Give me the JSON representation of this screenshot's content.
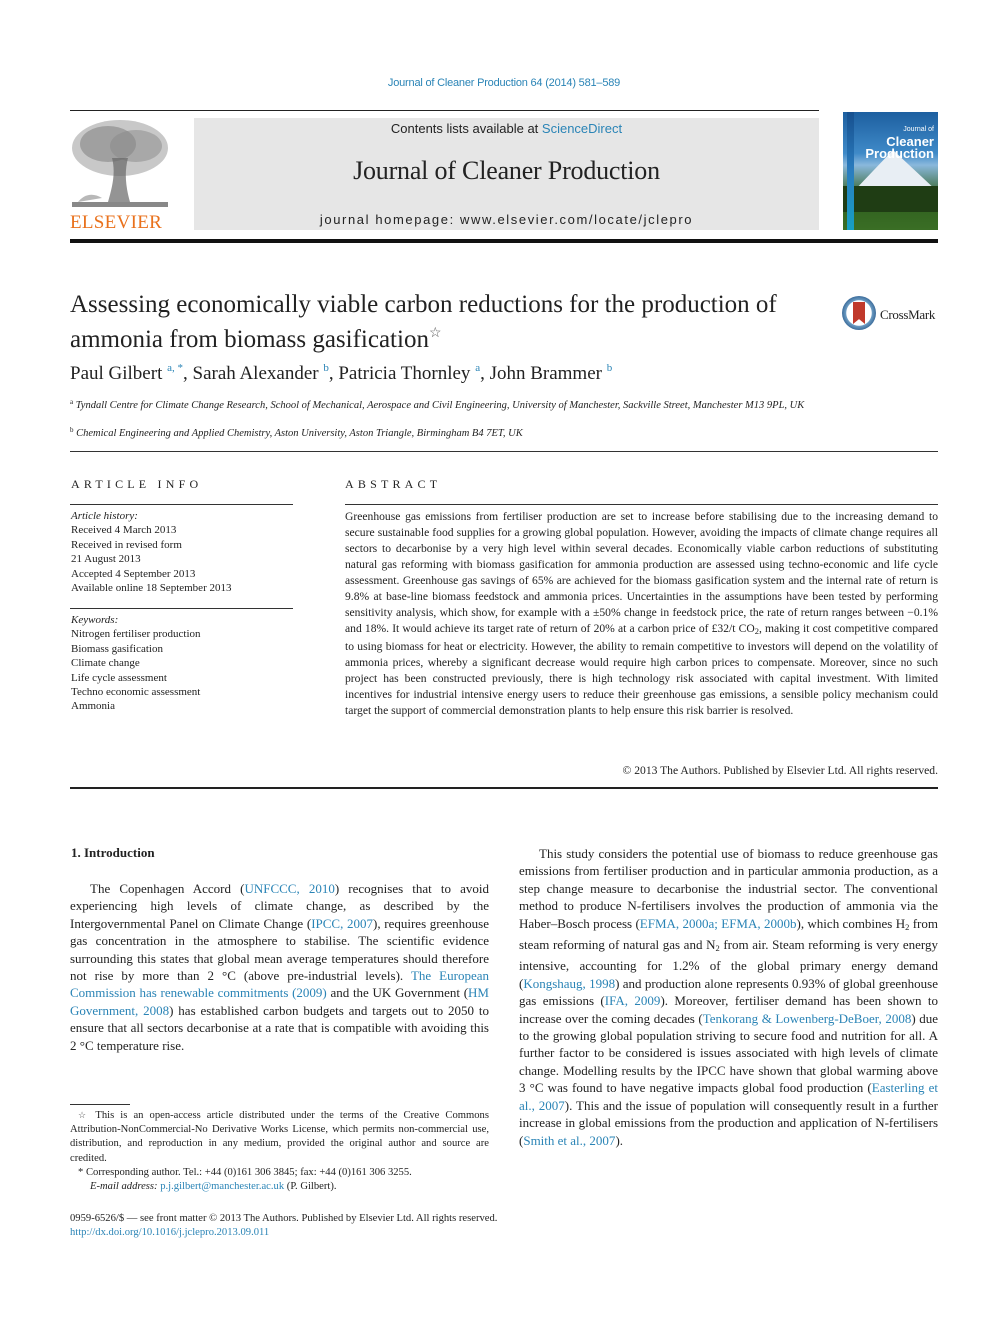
{
  "header": {
    "citation": "Journal of Cleaner Production 64 (2014) 581–589",
    "contents_prefix": "Contents lists available at ",
    "contents_link": "ScienceDirect",
    "journal_title": "Journal of Cleaner Production",
    "homepage": "journal homepage: www.elsevier.com/locate/jclepro",
    "publisher_logo": "ELSEVIER",
    "cover": {
      "line1": "Journal of",
      "line2": "Cleaner",
      "line3": "Production"
    },
    "crossmark_label": "CrossMark"
  },
  "colors": {
    "link": "#2a84b6",
    "elsevier_orange": "#e9711c",
    "masthead_bg": "#e6e6e6"
  },
  "article": {
    "title": "Assessing economically viable carbon reductions for the production of ammonia from biomass gasification",
    "title_mark": "☆",
    "authors": [
      {
        "name": "Paul Gilbert",
        "aff": "a, *"
      },
      {
        "name": "Sarah Alexander",
        "aff": "b"
      },
      {
        "name": "Patricia Thornley",
        "aff": "a"
      },
      {
        "name": "John Brammer",
        "aff": "b"
      }
    ],
    "affiliations": [
      {
        "key": "a",
        "text": "Tyndall Centre for Climate Change Research, School of Mechanical, Aerospace and Civil Engineering, University of Manchester, Sackville Street, Manchester M13 9PL, UK"
      },
      {
        "key": "b",
        "text": "Chemical Engineering and Applied Chemistry, Aston University, Aston Triangle, Birmingham B4 7ET, UK"
      }
    ]
  },
  "article_info": {
    "heading": "ARTICLE INFO",
    "history_label": "Article history:",
    "history": [
      "Received 4 March 2013",
      "Received in revised form",
      "21 August 2013",
      "Accepted 4 September 2013",
      "Available online 18 September 2013"
    ],
    "keywords_label": "Keywords:",
    "keywords": [
      "Nitrogen fertiliser production",
      "Biomass gasification",
      "Climate change",
      "Life cycle assessment",
      "Techno economic assessment",
      "Ammonia"
    ]
  },
  "abstract": {
    "heading": "ABSTRACT",
    "text_1": "Greenhouse gas emissions from fertiliser production are set to increase before stabilising due to the increasing demand to secure sustainable food supplies for a growing global population. However, avoiding the impacts of climate change requires all sectors to decarbonise by a very high level within several decades. Economically viable carbon reductions of substituting natural gas reforming with biomass gasification for ammonia production are assessed using techno-economic and life cycle assessment. Greenhouse gas savings of 65% are achieved for the biomass gasification system and the internal rate of return is 9.8% at base-line biomass feedstock and ammonia prices. Uncertainties in the assumptions have been tested by performing sensitivity analysis, which show, for example with a ±50% change in feedstock price, the rate of return ranges between −0.1% and 18%. It would achieve its target rate of return of 20% at a carbon price of £32/t CO",
    "text_sub": "2",
    "text_2": ", making it cost competitive compared to using biomass for heat or electricity. However, the ability to remain competitive to investors will depend on the volatility of ammonia prices, whereby a significant decrease would require high carbon prices to compensate. Moreover, since no such project has been constructed previously, there is high technology risk associated with capital investment. With limited incentives for industrial intensive energy users to reduce their greenhouse gas emissions, a sensible policy mechanism could target the support of commercial demonstration plants to help ensure this risk barrier is resolved.",
    "copyright": "© 2013 The Authors. Published by Elsevier Ltd. All rights reserved."
  },
  "intro": {
    "heading": "1.  Introduction",
    "left": {
      "t1": "The Copenhagen Accord (",
      "l1": "UNFCCC, 2010",
      "t2": ") recognises that to avoid experiencing high levels of climate change, as described by the Intergovernmental Panel on Climate Change (",
      "l2": "IPCC, 2007",
      "t3": "), requires greenhouse gas concentration in the atmosphere to stabilise. The scientific evidence surrounding this states that global mean average temperatures should therefore not rise by more than 2 °C (above pre-industrial levels). ",
      "l3": "The European Commission has renewable commitments (2009)",
      "t4": " and the UK Government (",
      "l4": "HM Government, 2008",
      "t5": ") has established carbon budgets and targets out to 2050 to ensure that all sectors decarbonise at a rate that is compatible with avoiding this 2 °C temperature rise."
    },
    "right": {
      "t1": "This study considers the potential use of biomass to reduce greenhouse gas emissions from fertiliser production and in particular ammonia production, as a step change measure to decarbonise the industrial sector. The conventional method to produce N-fertilisers involves the production of ammonia via the Haber–Bosch process (",
      "l1": "EFMA, 2000a; EFMA, 2000b",
      "t2": "), which combines H",
      "sub1": "2",
      "t3": " from steam reforming of natural gas and N",
      "sub2": "2",
      "t4": " from air. Steam reforming is very energy intensive, accounting for 1.2% of the global primary energy demand (",
      "l2": "Kongshaug, 1998",
      "t5": ") and production alone represents 0.93% of global greenhouse gas emissions (",
      "l3": "IFA, 2009",
      "t6": "). Moreover, fertiliser demand has been shown to increase over the coming decades (",
      "l4": "Tenkorang & Lowenberg-DeBoer, 2008",
      "t7": ") due to the growing global population striving to secure food and nutrition for all. A further factor to be considered is issues associated with high levels of climate change. Modelling results by the IPCC have shown that global warming above 3 °C was found to have negative impacts global food production (",
      "l5": "Easterling et al., 2007",
      "t8": "). This and the issue of population will consequently result in a further increase in global emissions from the production and application of N-fertilisers (",
      "l6": "Smith et al., 2007",
      "t9": ")."
    }
  },
  "footnotes": {
    "star_mark": "☆",
    "license": "This is an open-access article distributed under the terms of the Creative Commons Attribution-NonCommercial-No Derivative Works License, which permits non-commercial use, distribution, and reproduction in any medium, provided the original author and source are credited.",
    "corr_mark": "*",
    "corresponding": "Corresponding author. Tel.: +44 (0)161 306 3845; fax: +44 (0)161 306 3255.",
    "email_label": "E-mail address:",
    "email": "p.j.gilbert@manchester.ac.uk",
    "email_suffix": " (P. Gilbert)."
  },
  "front_matter": {
    "issn_line": "0959-6526/$ — see front matter © 2013 The Authors. Published by Elsevier Ltd. All rights reserved.",
    "doi": "http://dx.doi.org/10.1016/j.jclepro.2013.09.011"
  }
}
